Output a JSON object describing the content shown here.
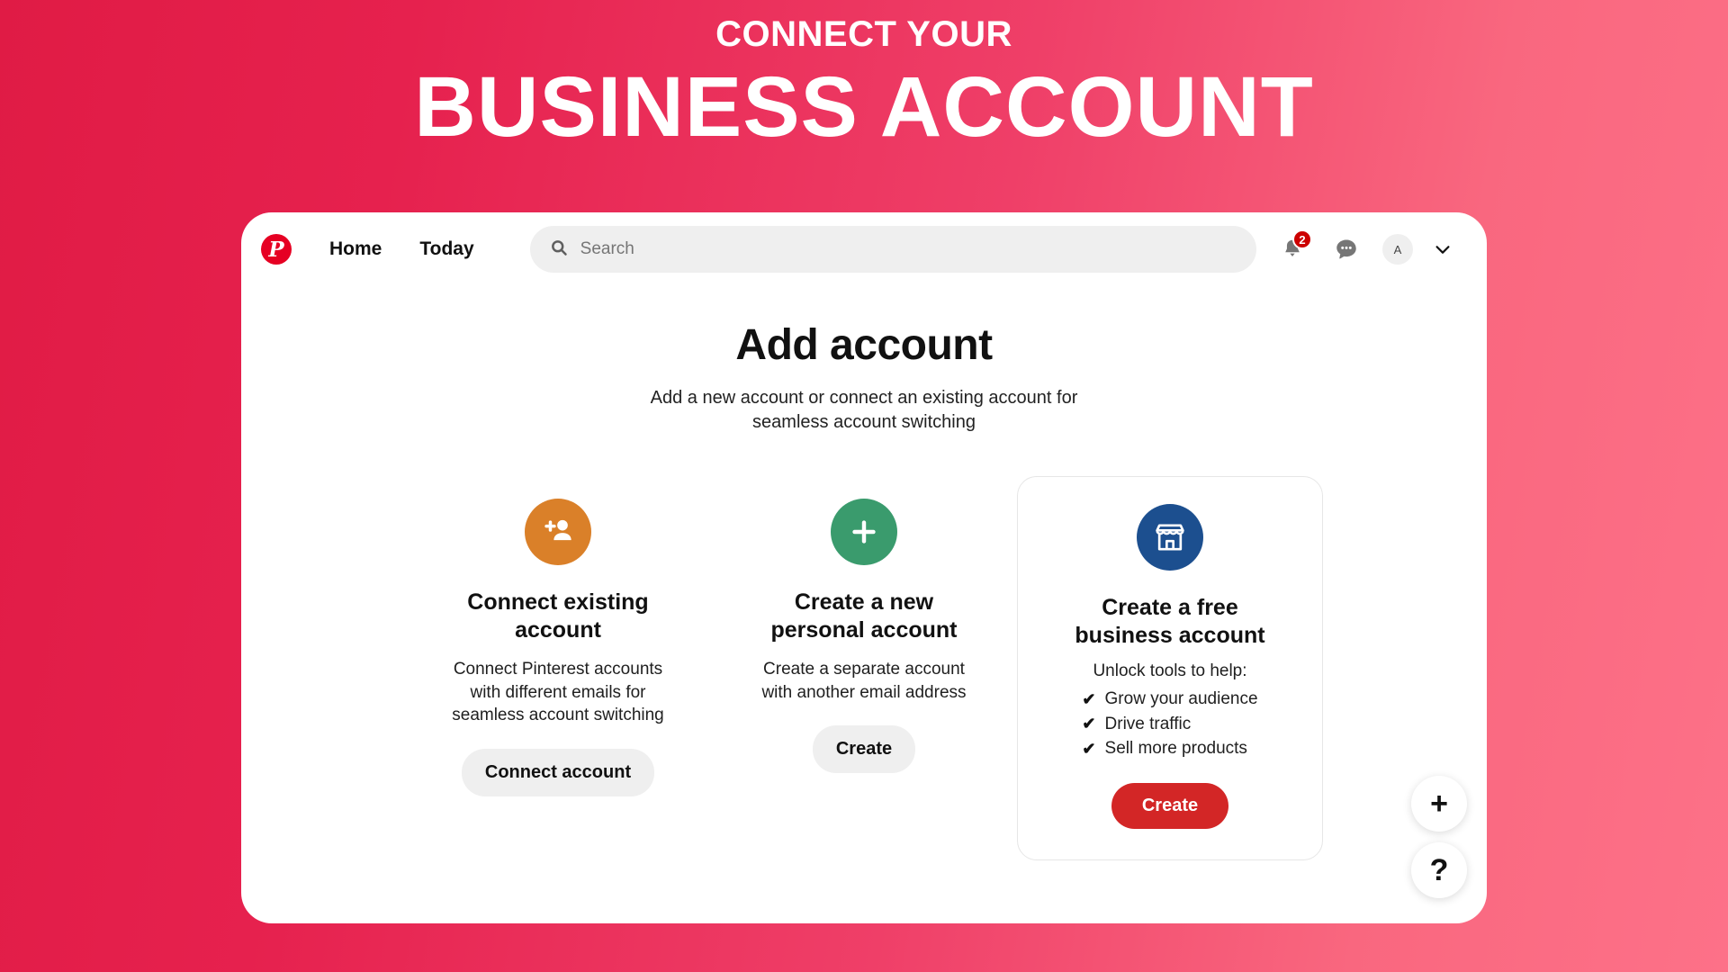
{
  "promo": {
    "line1": "CONNECT YOUR",
    "line2": "BUSINESS ACCOUNT",
    "bg_gradient_start": "#e01b45",
    "bg_gradient_end": "#fd7188",
    "text_color": "#ffffff"
  },
  "navbar": {
    "logo_letter": "P",
    "logo_color": "#e60023",
    "links": [
      {
        "label": "Home"
      },
      {
        "label": "Today"
      }
    ],
    "search": {
      "placeholder": "Search",
      "value": "",
      "icon": "search-icon"
    },
    "actions": {
      "notifications": {
        "icon": "bell-icon",
        "badge_count": "2",
        "badge_color": "#cc0000"
      },
      "messages": {
        "icon": "message-bubble-icon"
      },
      "avatar": {
        "initial": "A"
      },
      "account_menu": {
        "icon": "chevron-down-icon"
      }
    }
  },
  "main": {
    "title": "Add account",
    "subtitle": "Add a new account or connect an existing account for seamless account switching",
    "cards": [
      {
        "id": "connect-existing",
        "icon": "person-add-icon",
        "icon_bg": "#da8029",
        "title": "Connect existing account",
        "description": "Connect Pinterest accounts with different emails for seamless account switching",
        "button_label": "Connect account",
        "button_style": "gray"
      },
      {
        "id": "create-personal",
        "icon": "plus-icon",
        "icon_bg": "#3a9b6d",
        "title": "Create a new personal account",
        "description": "Create a separate account with another email address",
        "button_label": "Create",
        "button_style": "gray"
      },
      {
        "id": "create-business",
        "icon": "storefront-icon",
        "icon_bg": "#1c4f8f",
        "title": "Create a free business account",
        "benefits_heading": "Unlock tools to help:",
        "benefits": [
          "Grow your audience",
          "Drive traffic",
          "Sell more products"
        ],
        "button_label": "Create",
        "button_style": "red",
        "button_color": "#d32626",
        "highlighted": true
      }
    ]
  },
  "floating_actions": [
    {
      "icon": "plus-icon",
      "glyph": "+"
    },
    {
      "icon": "question-mark-icon",
      "glyph": "?"
    }
  ]
}
